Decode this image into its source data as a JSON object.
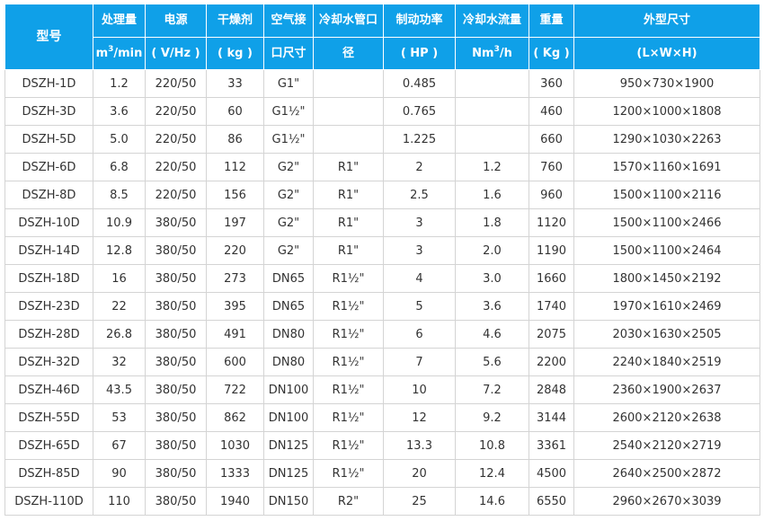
{
  "header": {
    "model": "型号",
    "capacity": "处理量",
    "capacity_unit_a": "m",
    "capacity_unit_sup": "3",
    "capacity_unit_b": "/min",
    "power_supply": "电源",
    "power_supply_unit": "( V/Hz )",
    "desiccant": "干燥剂",
    "desiccant_unit": "( kg )",
    "air_port_a": "空气接",
    "air_port_b": "口尺寸",
    "cooling_pipe_a": "冷却水管口",
    "cooling_pipe_b": "径",
    "brake_power": "制动功率",
    "brake_power_unit": "( HP )",
    "cooling_flow": "冷却水流量",
    "cooling_flow_unit_a": "Nm",
    "cooling_flow_unit_sup": "3",
    "cooling_flow_unit_b": "/h",
    "weight": "重量",
    "weight_unit": "( Kg )",
    "dimensions": "外型尺寸",
    "dimensions_unit": "(L×W×H)"
  },
  "rows": [
    [
      "DSZH-1D",
      "1.2",
      "220/50",
      "33",
      "G1\"",
      "",
      "0.485",
      "",
      "360",
      "950×730×1900"
    ],
    [
      "DSZH-3D",
      "3.6",
      "220/50",
      "60",
      "G1½\"",
      "",
      "0.765",
      "",
      "460",
      "1200×1000×1808"
    ],
    [
      "DSZH-5D",
      "5.0",
      "220/50",
      "86",
      "G1½\"",
      "",
      "1.225",
      "",
      "660",
      "1290×1030×2263"
    ],
    [
      "DSZH-6D",
      "6.8",
      "220/50",
      "112",
      "G2\"",
      "R1\"",
      "2",
      "1.2",
      "760",
      "1570×1160×1691"
    ],
    [
      "DSZH-8D",
      "8.5",
      "220/50",
      "156",
      "G2\"",
      "R1\"",
      "2.5",
      "1.6",
      "960",
      "1500×1100×2116"
    ],
    [
      "DSZH-10D",
      "10.9",
      "380/50",
      "197",
      "G2\"",
      "R1\"",
      "3",
      "1.8",
      "1120",
      "1500×1100×2466"
    ],
    [
      "DSZH-14D",
      "12.8",
      "380/50",
      "220",
      "G2\"",
      "R1\"",
      "3",
      "2.0",
      "1190",
      "1500×1100×2464"
    ],
    [
      "DSZH-18D",
      "16",
      "380/50",
      "273",
      "DN65",
      "R1½\"",
      "4",
      "3.0",
      "1660",
      "1800×1450×2192"
    ],
    [
      "DSZH-23D",
      "22",
      "380/50",
      "395",
      "DN65",
      "R1½\"",
      "5",
      "3.6",
      "1740",
      "1970×1610×2469"
    ],
    [
      "DSZH-28D",
      "26.8",
      "380/50",
      "491",
      "DN80",
      "R1½\"",
      "6",
      "4.6",
      "2075",
      "2030×1630×2505"
    ],
    [
      "DSZH-32D",
      "32",
      "380/50",
      "600",
      "DN80",
      "R1½\"",
      "7",
      "5.6",
      "2200",
      "2240×1840×2519"
    ],
    [
      "DSZH-46D",
      "43.5",
      "380/50",
      "722",
      "DN100",
      "R1½\"",
      "10",
      "7.2",
      "2848",
      "2360×1900×2637"
    ],
    [
      "DSZH-55D",
      "53",
      "380/50",
      "862",
      "DN100",
      "R1½\"",
      "12",
      "9.2",
      "3144",
      "2600×2120×2638"
    ],
    [
      "DSZH-65D",
      "67",
      "380/50",
      "1030",
      "DN125",
      "R1½\"",
      "13.3",
      "10.8",
      "3361",
      "2540×2120×2719"
    ],
    [
      "DSZH-85D",
      "90",
      "380/50",
      "1333",
      "DN125",
      "R1½\"",
      "20",
      "12.4",
      "4500",
      "2640×2500×2872"
    ],
    [
      "DSZH-110D",
      "110",
      "380/50",
      "1940",
      "DN150",
      "R2\"",
      "25",
      "14.6",
      "6550",
      "2960×2670×3039"
    ]
  ]
}
